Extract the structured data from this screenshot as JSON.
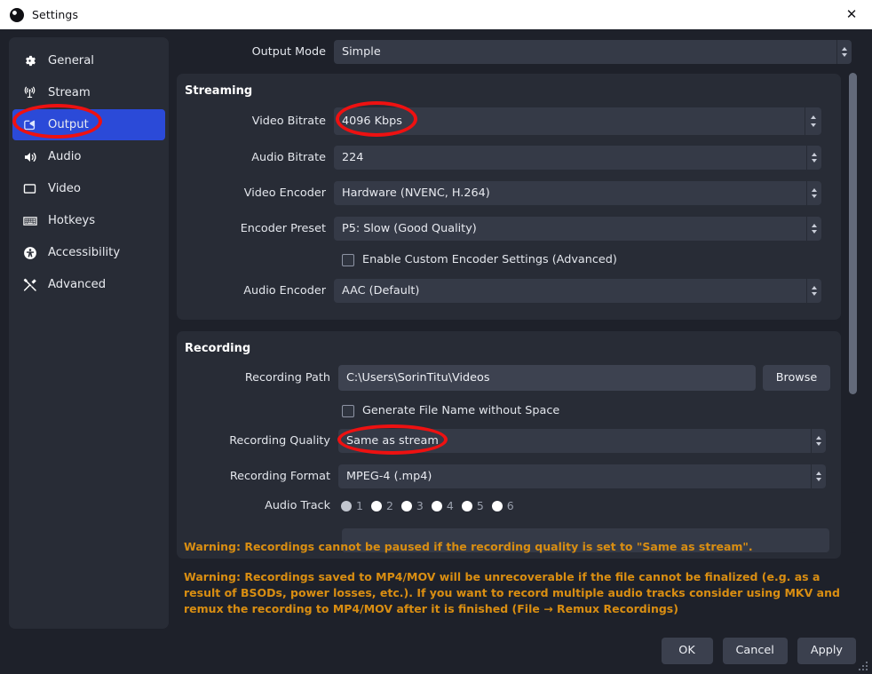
{
  "window": {
    "title": "Settings",
    "app_icon": "obs-logo-icon",
    "close_icon": "close-icon"
  },
  "sidebar": {
    "items": [
      {
        "label": "General",
        "icon": "gear-icon",
        "selected": false
      },
      {
        "label": "Stream",
        "icon": "broadcast-icon",
        "selected": false
      },
      {
        "label": "Output",
        "icon": "output-screen-icon",
        "selected": true
      },
      {
        "label": "Audio",
        "icon": "speaker-icon",
        "selected": false
      },
      {
        "label": "Video",
        "icon": "monitor-icon",
        "selected": false
      },
      {
        "label": "Hotkeys",
        "icon": "keyboard-icon",
        "selected": false
      },
      {
        "label": "Accessibility",
        "icon": "accessibility-icon",
        "selected": false
      },
      {
        "label": "Advanced",
        "icon": "tools-icon",
        "selected": false
      }
    ]
  },
  "output_mode": {
    "label": "Output Mode",
    "value": "Simple"
  },
  "streaming": {
    "title": "Streaming",
    "video_bitrate": {
      "label": "Video Bitrate",
      "value": "4096 Kbps"
    },
    "audio_bitrate": {
      "label": "Audio Bitrate",
      "value": "224"
    },
    "video_encoder": {
      "label": "Video Encoder",
      "value": "Hardware (NVENC, H.264)"
    },
    "encoder_preset": {
      "label": "Encoder Preset",
      "value": "P5: Slow (Good Quality)"
    },
    "custom_encoder": {
      "label": "Enable Custom Encoder Settings (Advanced)",
      "checked": false
    },
    "audio_encoder": {
      "label": "Audio Encoder",
      "value": "AAC (Default)"
    }
  },
  "recording": {
    "title": "Recording",
    "recording_path": {
      "label": "Recording Path",
      "value": "C:\\Users\\SorinTitu\\Videos"
    },
    "browse_label": "Browse",
    "generate_no_space": {
      "label": "Generate File Name without Space",
      "checked": false
    },
    "recording_quality": {
      "label": "Recording Quality",
      "value": "Same as stream"
    },
    "recording_format": {
      "label": "Recording Format",
      "value": "MPEG-4 (.mp4)"
    },
    "audio_track": {
      "label": "Audio Track",
      "options": [
        "1",
        "2",
        "3",
        "4",
        "5",
        "6"
      ],
      "selected": "1"
    }
  },
  "warnings": [
    "Warning: Recordings cannot be paused if the recording quality is set to \"Same as stream\".",
    "Warning: Recordings saved to MP4/MOV will be unrecoverable if the file cannot be finalized (e.g. as a result of BSODs, power losses, etc.). If you want to record multiple audio tracks consider using MKV and remux the recording to MP4/MOV after it is finished (File → Remux Recordings)"
  ],
  "footer": {
    "ok": "OK",
    "cancel": "Cancel",
    "apply": "Apply"
  },
  "annotations": {
    "color": "#ee1111",
    "targets": [
      "sidebar-item-output",
      "video-bitrate-value",
      "recording-quality-value"
    ]
  }
}
